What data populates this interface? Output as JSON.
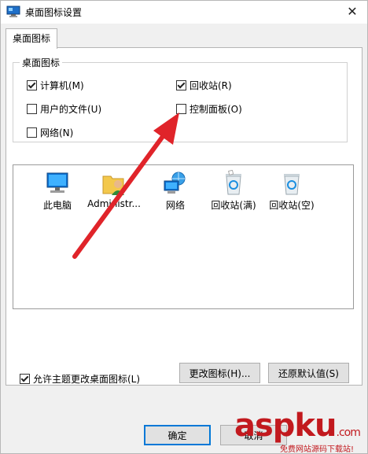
{
  "window": {
    "title": "桌面图标设置",
    "close_glyph": "✕"
  },
  "tabs": [
    {
      "label": "桌面图标",
      "selected": true
    }
  ],
  "desktop_icons_group": {
    "title": "桌面图标",
    "checkboxes": [
      {
        "label": "计算机(M)",
        "checked": true
      },
      {
        "label": "回收站(R)",
        "checked": true
      },
      {
        "label": "用户的文件(U)",
        "checked": false
      },
      {
        "label": "控制面板(O)",
        "checked": false
      },
      {
        "label": "网络(N)",
        "checked": false
      }
    ]
  },
  "icon_list": [
    {
      "label": "此电脑",
      "icon": "computer-icon"
    },
    {
      "label": "Administr...",
      "icon": "user-folder-icon"
    },
    {
      "label": "网络",
      "icon": "network-icon"
    },
    {
      "label": "回收站(满)",
      "icon": "recycle-bin-full-icon"
    },
    {
      "label": "回收站(空)",
      "icon": "recycle-bin-empty-icon"
    }
  ],
  "buttons": {
    "change_icon": "更改图标(H)...",
    "restore_default": "还原默认值(S)",
    "ok": "确定",
    "cancel": "取消"
  },
  "allow_themes": {
    "label": "允许主题更改桌面图标(L)",
    "checked": true
  },
  "annotation": {
    "color": "#e0242a"
  },
  "watermark": {
    "text": "aspku",
    "suffix": ".com",
    "sub": "免费网站源码下载站!",
    "color": "#c2191e"
  }
}
